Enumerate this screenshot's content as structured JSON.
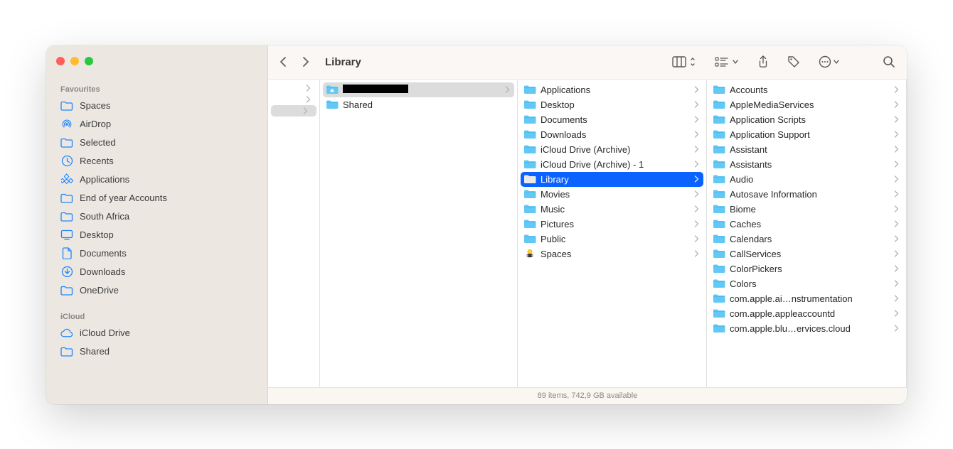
{
  "window_title": "Library",
  "sidebar": {
    "sections": [
      {
        "title": "Favourites",
        "items": [
          {
            "label": "Spaces",
            "icon": "folder-icon"
          },
          {
            "label": "AirDrop",
            "icon": "airdrop-icon"
          },
          {
            "label": "Selected",
            "icon": "folder-icon"
          },
          {
            "label": "Recents",
            "icon": "clock-icon"
          },
          {
            "label": "Applications",
            "icon": "app-grid-icon"
          },
          {
            "label": "End of year Accounts",
            "icon": "folder-icon"
          },
          {
            "label": "South Africa",
            "icon": "folder-icon"
          },
          {
            "label": "Desktop",
            "icon": "desktop-icon"
          },
          {
            "label": "Documents",
            "icon": "document-icon"
          },
          {
            "label": "Downloads",
            "icon": "downloads-icon"
          },
          {
            "label": "OneDrive",
            "icon": "folder-icon"
          }
        ]
      },
      {
        "title": "iCloud",
        "items": [
          {
            "label": "iCloud Drive",
            "icon": "cloud-icon"
          },
          {
            "label": "Shared",
            "icon": "folder-icon"
          }
        ]
      }
    ]
  },
  "columns": [
    {
      "items": [
        {
          "label": "",
          "icon": "none",
          "has_children": true,
          "selected": "none"
        },
        {
          "label": "",
          "icon": "none",
          "has_children": true,
          "selected": "none"
        },
        {
          "label": "",
          "icon": "none",
          "has_children": true,
          "selected": "gray"
        }
      ]
    },
    {
      "items": [
        {
          "label": "[redacted]",
          "icon": "home-folder",
          "has_children": true,
          "selected": "gray",
          "redacted": true
        },
        {
          "label": "Shared",
          "icon": "folder",
          "has_children": false,
          "selected": "none"
        }
      ]
    },
    {
      "items": [
        {
          "label": "Applications",
          "icon": "folder",
          "has_children": true,
          "selected": "none"
        },
        {
          "label": "Desktop",
          "icon": "folder",
          "has_children": true,
          "selected": "none"
        },
        {
          "label": "Documents",
          "icon": "folder",
          "has_children": true,
          "selected": "none"
        },
        {
          "label": "Downloads",
          "icon": "folder",
          "has_children": true,
          "selected": "none"
        },
        {
          "label": "iCloud Drive (Archive)",
          "icon": "folder",
          "has_children": true,
          "selected": "none"
        },
        {
          "label": "iCloud Drive (Archive) - 1",
          "icon": "folder",
          "has_children": true,
          "selected": "none"
        },
        {
          "label": "Library",
          "icon": "folder",
          "has_children": true,
          "selected": "blue"
        },
        {
          "label": "Movies",
          "icon": "folder",
          "has_children": true,
          "selected": "none"
        },
        {
          "label": "Music",
          "icon": "folder",
          "has_children": true,
          "selected": "none"
        },
        {
          "label": "Pictures",
          "icon": "folder",
          "has_children": true,
          "selected": "none"
        },
        {
          "label": "Public",
          "icon": "folder",
          "has_children": true,
          "selected": "none"
        },
        {
          "label": "Spaces",
          "icon": "spaces",
          "has_children": true,
          "selected": "none"
        }
      ]
    },
    {
      "items": [
        {
          "label": "Accounts",
          "icon": "folder",
          "has_children": true,
          "selected": "none"
        },
        {
          "label": "AppleMediaServices",
          "icon": "folder",
          "has_children": true,
          "selected": "none"
        },
        {
          "label": "Application Scripts",
          "icon": "folder",
          "has_children": true,
          "selected": "none"
        },
        {
          "label": "Application Support",
          "icon": "folder",
          "has_children": true,
          "selected": "none"
        },
        {
          "label": "Assistant",
          "icon": "folder",
          "has_children": true,
          "selected": "none"
        },
        {
          "label": "Assistants",
          "icon": "folder",
          "has_children": true,
          "selected": "none"
        },
        {
          "label": "Audio",
          "icon": "folder",
          "has_children": true,
          "selected": "none"
        },
        {
          "label": "Autosave Information",
          "icon": "folder",
          "has_children": true,
          "selected": "none"
        },
        {
          "label": "Biome",
          "icon": "folder",
          "has_children": true,
          "selected": "none"
        },
        {
          "label": "Caches",
          "icon": "folder",
          "has_children": true,
          "selected": "none"
        },
        {
          "label": "Calendars",
          "icon": "folder",
          "has_children": true,
          "selected": "none"
        },
        {
          "label": "CallServices",
          "icon": "folder",
          "has_children": true,
          "selected": "none"
        },
        {
          "label": "ColorPickers",
          "icon": "folder",
          "has_children": true,
          "selected": "none"
        },
        {
          "label": "Colors",
          "icon": "folder",
          "has_children": true,
          "selected": "none"
        },
        {
          "label": "com.apple.ai…nstrumentation",
          "icon": "folder",
          "has_children": true,
          "selected": "none"
        },
        {
          "label": "com.apple.appleaccountd",
          "icon": "folder",
          "has_children": true,
          "selected": "none"
        },
        {
          "label": "com.apple.blu…ervices.cloud",
          "icon": "folder",
          "has_children": true,
          "selected": "none"
        }
      ]
    }
  ],
  "statusbar": "89 items, 742,9 GB available"
}
